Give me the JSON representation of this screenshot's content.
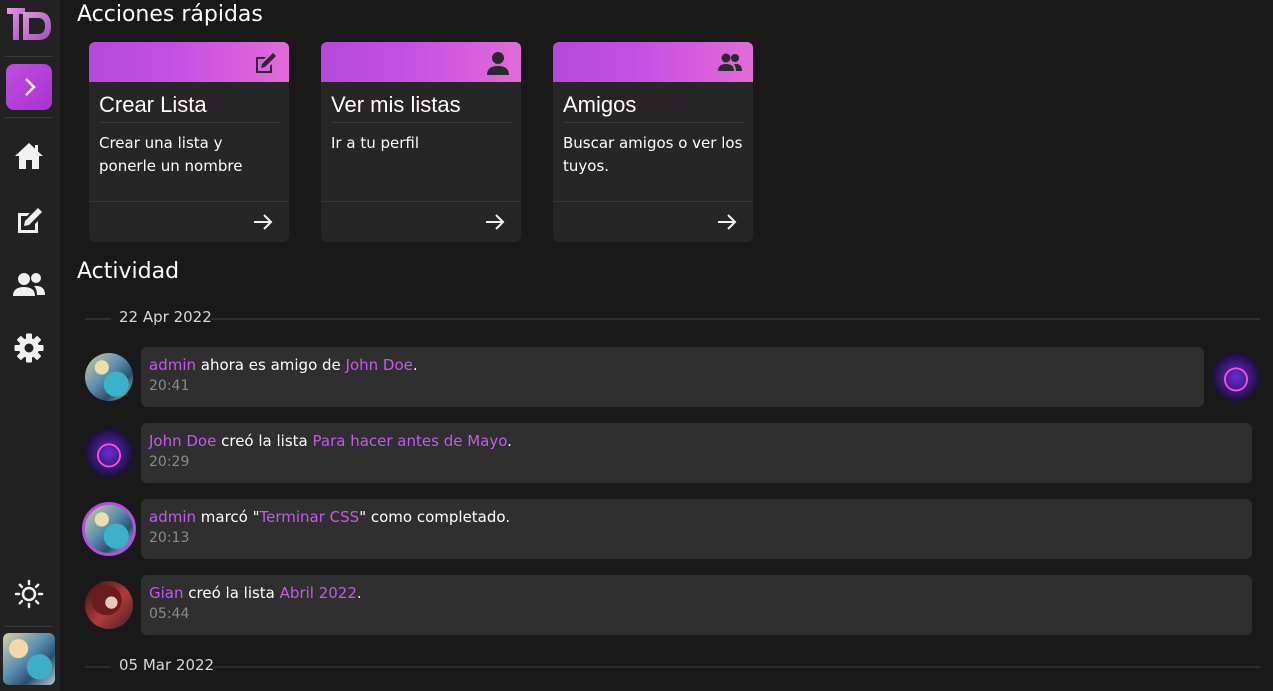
{
  "sidebar": {
    "nav": [
      {
        "icon": "home-icon"
      },
      {
        "icon": "edit-icon"
      },
      {
        "icon": "friends-icon"
      },
      {
        "icon": "gear-icon"
      }
    ],
    "theme_icon": "sun-icon"
  },
  "quick_actions": {
    "title": "Acciones rápidas",
    "cards": [
      {
        "title": "Crear Lista",
        "description": "Crear una lista y ponerle un nombre",
        "icon": "edit-icon"
      },
      {
        "title": "Ver mis listas",
        "description": "Ir a tu perfil",
        "icon": "person-icon"
      },
      {
        "title": "Amigos",
        "description": "Buscar amigos o ver los tuyos.",
        "icon": "friends-icon"
      }
    ]
  },
  "activity": {
    "title": "Actividad",
    "dates": [
      "22 Apr 2022",
      "05 Mar 2022"
    ],
    "items": [
      {
        "user": "admin",
        "pre": " ahora es amigo de ",
        "target": "John Doe",
        "post": ".",
        "time": "20:41"
      },
      {
        "user": "John Doe",
        "pre": " creó la lista ",
        "target": "Para hacer antes de Mayo",
        "post": ".",
        "time": "20:29"
      },
      {
        "user": "admin",
        "pre": " marcó \"",
        "target": "Terminar CSS",
        "post": "\" como completado.",
        "time": "20:13"
      },
      {
        "user": "Gian",
        "pre": " creó la lista ",
        "target": "Abril 2022",
        "post": ".",
        "time": "05:44"
      }
    ]
  },
  "colors": {
    "accent": "#c559ec",
    "background": "#191919",
    "sidebar": "#222222",
    "card": "#262626"
  }
}
